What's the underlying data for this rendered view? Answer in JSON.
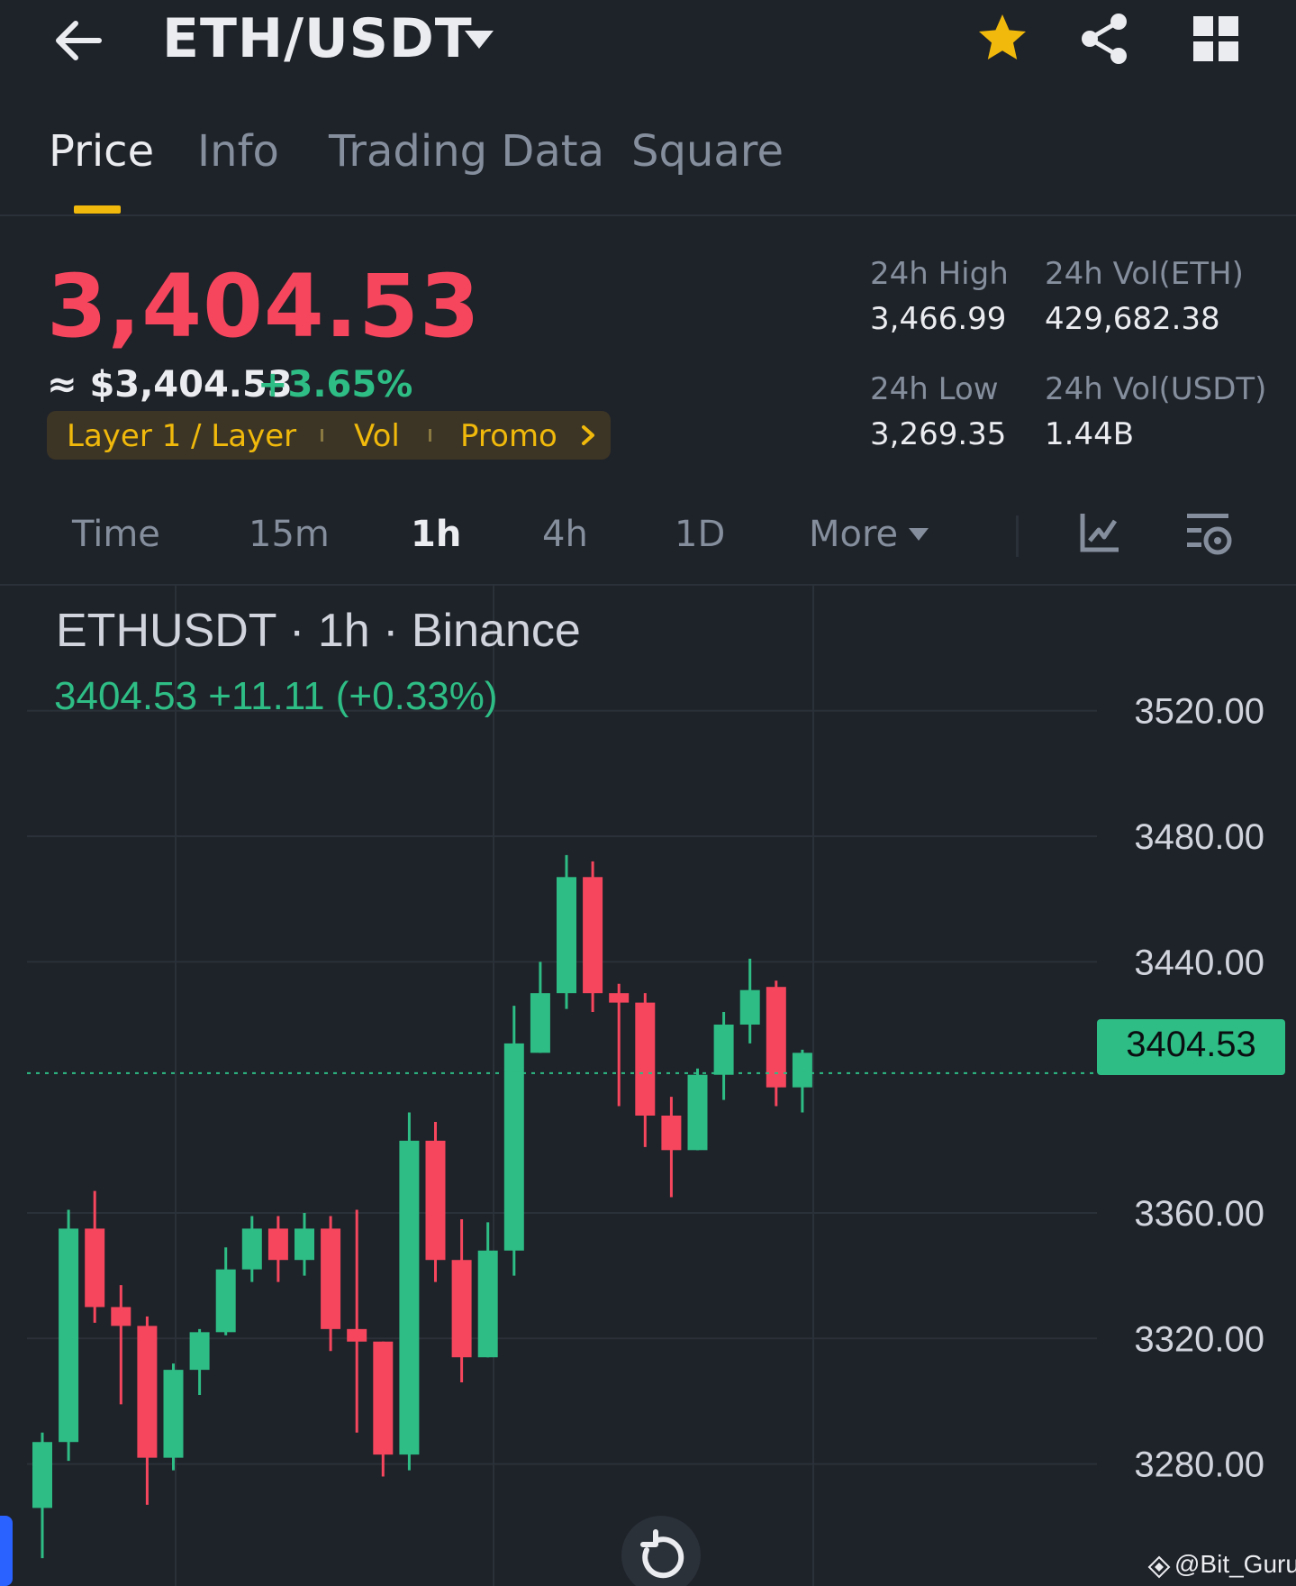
{
  "header": {
    "pair": "ETH/USDT",
    "icons": [
      "back-arrow-icon",
      "dropdown-caret-icon",
      "star-icon",
      "share-icon",
      "grid-icon"
    ],
    "star_color": "#f0b90b"
  },
  "tabs": [
    {
      "label": "Price",
      "active": true
    },
    {
      "label": "Info",
      "active": false
    },
    {
      "label": "Trading Data",
      "active": false
    },
    {
      "label": "Square",
      "active": false
    }
  ],
  "price": {
    "last": "3,404.53",
    "usd": "≈ $3,404.53",
    "change_pct": "+3.65%",
    "color_down": "#f6465d",
    "color_up": "#2ebd85"
  },
  "tags": {
    "items": [
      "Layer 1 / Layer",
      "Vol",
      "Promo"
    ]
  },
  "stats": {
    "high_label": "24h High",
    "high_value": "3,466.99",
    "low_label": "24h Low",
    "low_value": "3,269.35",
    "vol_eth_label": "24h Vol(ETH)",
    "vol_eth_value": "429,682.38",
    "vol_usdt_label": "24h Vol(USDT)",
    "vol_usdt_value": "1.44B"
  },
  "intervals": {
    "items": [
      "Time",
      "15m",
      "1h",
      "4h",
      "1D",
      "More"
    ],
    "active": "1h"
  },
  "chart": {
    "title": "ETHUSDT · 1h · Binance",
    "ohlc_line": "3404.53  +11.11 (+0.33%)",
    "current_price_label": "3404.53",
    "watermark": "@Bit_Guru"
  },
  "chart_data": {
    "type": "candlestick",
    "symbol": "ETHUSDT",
    "interval": "1h",
    "exchange": "Binance",
    "y_ticks": [
      3520,
      3480,
      3440,
      3360,
      3320,
      3280
    ],
    "y_tick_labels": [
      "3520.00",
      "3480.00",
      "3440.00",
      "3360.00",
      "3320.00",
      "3280.00"
    ],
    "ylim": [
      3244,
      3538
    ],
    "current_price": 3404.53,
    "candles": [
      {
        "open": 3266,
        "close": 3287,
        "high": 3290,
        "low": 3250
      },
      {
        "open": 3287,
        "close": 3355,
        "high": 3361,
        "low": 3281
      },
      {
        "open": 3355,
        "close": 3330,
        "high": 3367,
        "low": 3325
      },
      {
        "open": 3330,
        "close": 3324,
        "high": 3337,
        "low": 3299
      },
      {
        "open": 3324,
        "close": 3282,
        "high": 3327,
        "low": 3267
      },
      {
        "open": 3282,
        "close": 3310,
        "high": 3312,
        "low": 3278
      },
      {
        "open": 3310,
        "close": 3322,
        "high": 3323,
        "low": 3302
      },
      {
        "open": 3322,
        "close": 3342,
        "high": 3349,
        "low": 3321
      },
      {
        "open": 3342,
        "close": 3355,
        "high": 3359,
        "low": 3338
      },
      {
        "open": 3355,
        "close": 3345,
        "high": 3359,
        "low": 3338
      },
      {
        "open": 3345,
        "close": 3355,
        "high": 3360,
        "low": 3340
      },
      {
        "open": 3355,
        "close": 3323,
        "high": 3359,
        "low": 3316
      },
      {
        "open": 3323,
        "close": 3319,
        "high": 3361,
        "low": 3290
      },
      {
        "open": 3319,
        "close": 3283,
        "high": 3319,
        "low": 3276
      },
      {
        "open": 3283,
        "close": 3383,
        "high": 3392,
        "low": 3278
      },
      {
        "open": 3383,
        "close": 3345,
        "high": 3389,
        "low": 3338
      },
      {
        "open": 3345,
        "close": 3314,
        "high": 3358,
        "low": 3306
      },
      {
        "open": 3314,
        "close": 3348,
        "high": 3357,
        "low": 3314
      },
      {
        "open": 3348,
        "close": 3414,
        "high": 3426,
        "low": 3340
      },
      {
        "open": 3411,
        "close": 3430,
        "high": 3440,
        "low": 3411
      },
      {
        "open": 3430,
        "close": 3467,
        "high": 3474,
        "low": 3425
      },
      {
        "open": 3467,
        "close": 3430,
        "high": 3472,
        "low": 3424
      },
      {
        "open": 3430,
        "close": 3427,
        "high": 3433,
        "low": 3394
      },
      {
        "open": 3427,
        "close": 3391,
        "high": 3430,
        "low": 3381
      },
      {
        "open": 3391,
        "close": 3380,
        "high": 3397,
        "low": 3365
      },
      {
        "open": 3380,
        "close": 3404,
        "high": 3406,
        "low": 3380
      },
      {
        "open": 3404,
        "close": 3420,
        "high": 3424,
        "low": 3396
      },
      {
        "open": 3420,
        "close": 3431,
        "high": 3441,
        "low": 3414
      },
      {
        "open": 3432,
        "close": 3400,
        "high": 3434,
        "low": 3394
      },
      {
        "open": 3400,
        "close": 3411,
        "high": 3412,
        "low": 3392
      }
    ]
  }
}
